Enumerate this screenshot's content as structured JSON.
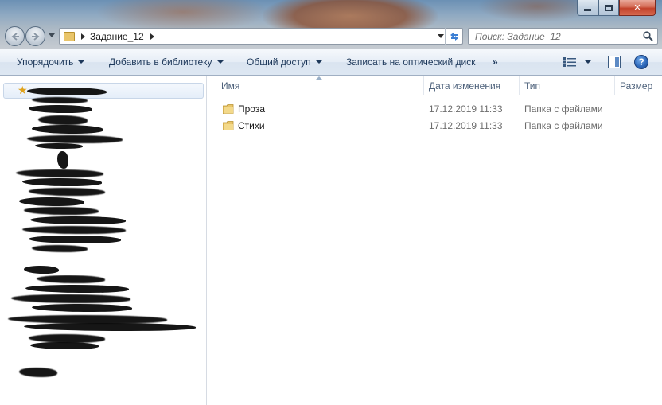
{
  "window": {
    "controls": {
      "minimize": "",
      "maximize": "",
      "close": "✕"
    }
  },
  "address": {
    "path": "Задание_12"
  },
  "search": {
    "placeholder": "Поиск: Задание_12"
  },
  "toolbar": {
    "organize": "Упорядочить",
    "add_to_library": "Добавить в библиотеку",
    "share": "Общий доступ",
    "burn": "Записать на оптический диск",
    "more": "»",
    "help": "?"
  },
  "columns": {
    "name": "Имя",
    "date": "Дата изменения",
    "type": "Тип",
    "size": "Размер"
  },
  "files": [
    {
      "name": "Проза",
      "date": "17.12.2019 11:33",
      "type": "Папка с файлами",
      "icon": "folder-icon"
    },
    {
      "name": "Стихи",
      "date": "17.12.2019 11:33",
      "type": "Папка с файлами",
      "icon": "folder-icon"
    }
  ],
  "colors": {
    "folder": "#e9c56a",
    "command_text": "#1e395b",
    "header_text": "#4c607a",
    "secondary_text": "#6d6d6d"
  }
}
